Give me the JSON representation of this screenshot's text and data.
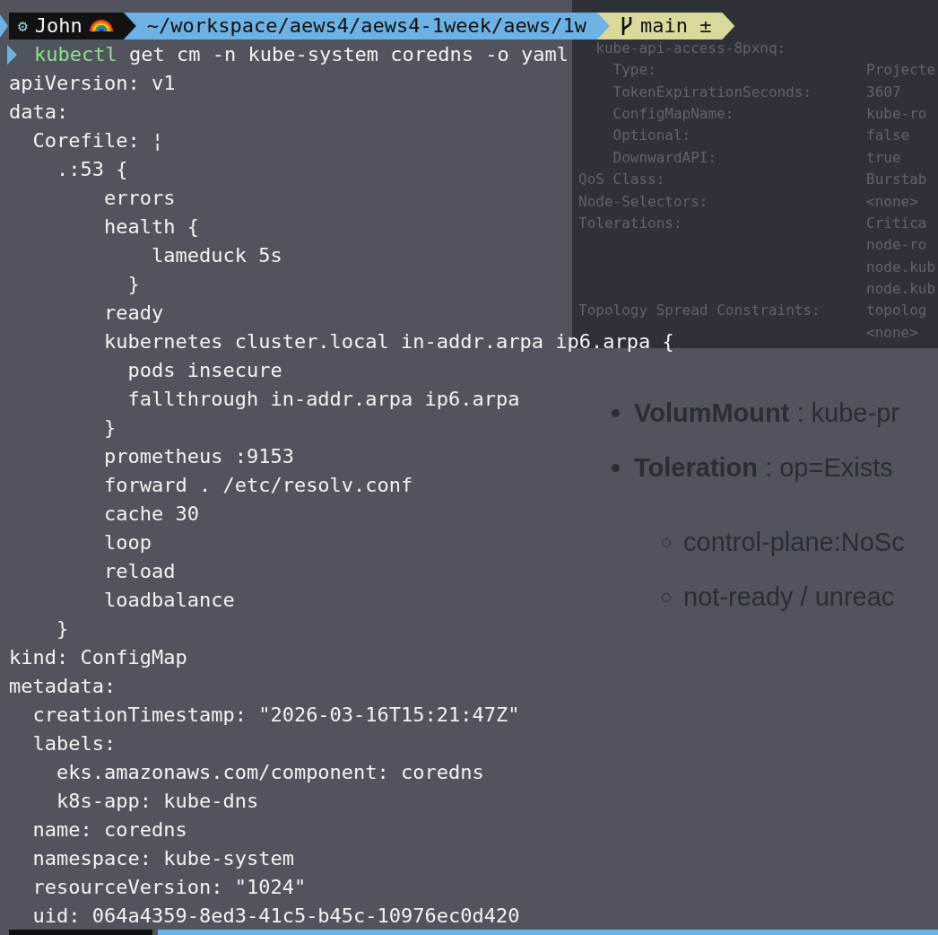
{
  "background_terminal": {
    "lines": [
      {
        "label": "  kube-api-access-8pxnq:"
      },
      {
        "label": "    Type:",
        "value": "Projecte"
      },
      {
        "label": "    TokenExpirationSeconds:",
        "value": "3607"
      },
      {
        "label": "    ConfigMapName:",
        "value": "kube-ro"
      },
      {
        "label": "    Optional:",
        "value": "false"
      },
      {
        "label": "    DownwardAPI:",
        "value": "true"
      },
      {
        "label": "QoS Class:",
        "value": "Burstab"
      },
      {
        "label": "Node-Selectors:",
        "value": "<none>"
      },
      {
        "label": "Tolerations:",
        "value": "Critica"
      },
      {
        "value": "node-ro"
      },
      {
        "value": "node.kub"
      },
      {
        "value": "node.kub"
      },
      {
        "label": "Topology Spread Constraints:",
        "value": "topolog"
      },
      {
        "value": "<none>"
      }
    ]
  },
  "document": {
    "bullets": [
      {
        "term": "VolumMount",
        "text": " : kube-pr"
      },
      {
        "term": "Toleration",
        "text": " : op=Exists",
        "children": [
          "control-plane:NoSc",
          "not-ready / unreac"
        ]
      }
    ]
  },
  "terminal": {
    "prompt": {
      "gear": "⚙",
      "user": "John",
      "path": "~/workspace/aews4/aews4-1week/aews/1w",
      "branch": "main ±"
    },
    "command": {
      "program": "kubectl",
      "args": " get cm -n kube-system coredns -o yaml"
    },
    "output": [
      "apiVersion: v1",
      "data:",
      "  Corefile: ¦",
      "    .:53 {",
      "        errors",
      "        health {",
      "            lameduck 5s",
      "          }",
      "        ready",
      "        kubernetes cluster.local in-addr.arpa ip6.arpa {",
      "          pods insecure",
      "          fallthrough in-addr.arpa ip6.arpa",
      "        }",
      "        prometheus :9153",
      "        forward . /etc/resolv.conf",
      "        cache 30",
      "        loop",
      "        reload",
      "        loadbalance",
      "    }",
      "kind: ConfigMap",
      "metadata:",
      "  creationTimestamp: \"2026-03-16T15:21:47Z\"",
      "  labels:",
      "    eks.amazonaws.com/component: coredns",
      "    k8s-app: kube-dns",
      "  name: coredns",
      "  namespace: kube-system",
      "  resourceVersion: \"1024\"",
      "  uid: 064a4359-8ed3-41c5-b45c-10976ec0d420"
    ]
  }
}
